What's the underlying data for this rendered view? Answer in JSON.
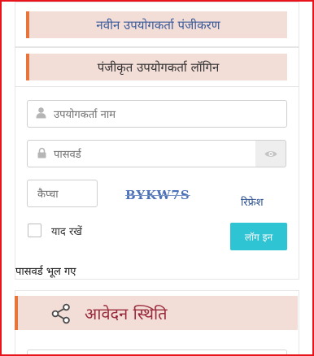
{
  "new_user_registration": {
    "label": "नवीन उपयोगकर्ता पंजीकरण"
  },
  "registered_user_login": {
    "label": "पंजीकृत उपयोगकर्ता लॉगिन"
  },
  "login_form": {
    "username_placeholder": "उपयोगकर्ता नाम",
    "password_placeholder": "पासवर्ड",
    "captcha_placeholder": "कैप्चा",
    "captcha_code": "BYKW7S",
    "refresh_label": "रिफ्रेश",
    "remember_label": "याद रखें",
    "login_button_label": "लॉग इन",
    "forgot_password_label": "पासवर्ड भूल गए"
  },
  "application_status": {
    "title": "आवेदन स्थिति"
  },
  "icons": {
    "user": "user-icon",
    "lock": "lock-icon",
    "eye": "eye-icon",
    "share": "share-icon"
  },
  "colors": {
    "accent_orange": "#e8743b",
    "heading_bg": "#f2ddd7",
    "login_button": "#2ec4d4",
    "status_title": "#9a2b3c",
    "frame_border": "#e8141b"
  }
}
